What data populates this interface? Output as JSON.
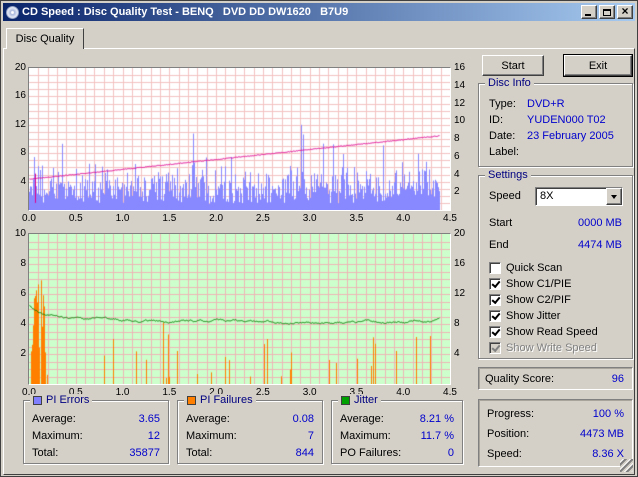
{
  "window": {
    "title": "CD Speed : Disc Quality Test - BENQ   DVD DD DW1620   B7U9"
  },
  "tab": {
    "label": "Disc Quality"
  },
  "buttons": {
    "start": "Start",
    "exit": "Exit"
  },
  "icons": {
    "app": "cd-disc-icon",
    "minimize": "minimize-icon",
    "maximize": "maximize-icon",
    "close": "close-icon",
    "speed_dropdown": "chevron-down-icon"
  },
  "colors": {
    "window_bg": "#d4d0c8",
    "titlebar_left": "#0a246a",
    "titlebar_right": "#a6caf0",
    "value_text": "#0000cc",
    "pi_errors": "#8080ff",
    "pi_failures": "#ff8000",
    "jitter": "#00a000",
    "read_speed": "#e00090"
  },
  "disc_info": {
    "title": "Disc Info",
    "rows": [
      {
        "label": "Type:",
        "value": "DVD+R"
      },
      {
        "label": "ID:",
        "value": "YUDEN000 T02"
      },
      {
        "label": "Date:",
        "value": "23 February 2005"
      },
      {
        "label": "Label:",
        "value": ""
      }
    ]
  },
  "settings": {
    "title": "Settings",
    "speed": {
      "label": "Speed",
      "value": "8X"
    },
    "fields": [
      {
        "label": "Start",
        "value": "0000 MB"
      },
      {
        "label": "End",
        "value": "4474 MB"
      }
    ],
    "checkboxes": [
      {
        "label": "Quick Scan",
        "checked": false,
        "enabled": true
      },
      {
        "label": "Show C1/PIE",
        "checked": true,
        "enabled": true
      },
      {
        "label": "Show C2/PIF",
        "checked": true,
        "enabled": true
      },
      {
        "label": "Show Jitter",
        "checked": true,
        "enabled": true
      },
      {
        "label": "Show Read Speed",
        "checked": true,
        "enabled": true
      },
      {
        "label": "Show Write Speed",
        "checked": true,
        "enabled": false
      }
    ]
  },
  "quality": {
    "label": "Quality Score:",
    "value": "96"
  },
  "status_panel": {
    "rows": [
      {
        "label": "Progress:",
        "value": "100 %"
      },
      {
        "label": "Position:",
        "value": "4473 MB"
      },
      {
        "label": "Speed:",
        "value": "8.36 X"
      }
    ]
  },
  "stats": {
    "boxes": [
      {
        "title": "PI Errors",
        "color": "#8080ff",
        "rows": [
          {
            "label": "Average:",
            "value": "3.65"
          },
          {
            "label": "Maximum:",
            "value": "12"
          },
          {
            "label": "Total:",
            "value": "35877"
          }
        ]
      },
      {
        "title": "PI Failures",
        "color": "#ff8000",
        "rows": [
          {
            "label": "Average:",
            "value": "0.08"
          },
          {
            "label": "Maximum:",
            "value": "7"
          },
          {
            "label": "Total:",
            "value": "844"
          }
        ]
      },
      {
        "title": "Jitter",
        "color": "#00a000",
        "rows": [
          {
            "label": "Average:",
            "value": "8.21 %"
          },
          {
            "label": "Maximum:",
            "value": "11.7 %"
          },
          {
            "label": "PO Failures:",
            "value": "0"
          }
        ]
      }
    ]
  },
  "chart_data": [
    {
      "type": "bar",
      "name": "PI Errors / Read Speed",
      "x_range": [
        0,
        4.5
      ],
      "x_unit": "GB",
      "x_ticks": [
        "0.0",
        "0.5",
        "1.0",
        "1.5",
        "2.0",
        "2.5",
        "3.0",
        "3.5",
        "4.0",
        "4.5"
      ],
      "left_axis": {
        "min": 0,
        "max": 20,
        "ticks": [
          20,
          16,
          12,
          8,
          4
        ]
      },
      "right_axis": {
        "min": 0,
        "max": 16,
        "ticks": [
          16,
          14,
          12,
          10,
          8,
          6,
          4,
          2
        ]
      },
      "background": "#ffffff",
      "grid_color": "#f4c2c2",
      "grid_divisions": {
        "x": 45,
        "y": 20
      },
      "data_end_x": 4.38,
      "series": [
        {
          "name": "PI Errors",
          "type": "spikes",
          "axis": "left",
          "color": "#8888ff",
          "average": 3.65,
          "maximum": 12,
          "total": 35877
        },
        {
          "name": "Read Speed",
          "type": "line",
          "axis": "right",
          "color": "#e00090",
          "start_value": 3.46,
          "end_value": 8.36
        }
      ]
    },
    {
      "type": "bar",
      "name": "PI Failures / Jitter",
      "x_range": [
        0,
        4.5
      ],
      "x_unit": "GB",
      "x_ticks": [
        "0.0",
        "0.5",
        "1.0",
        "1.5",
        "2.0",
        "2.5",
        "3.0",
        "3.5",
        "4.0",
        "4.5"
      ],
      "left_axis": {
        "min": 0,
        "max": 10,
        "ticks": [
          10,
          8,
          6,
          4,
          2
        ]
      },
      "right_axis": {
        "min": 0,
        "max": 20,
        "ticks": [
          20,
          16,
          12,
          8,
          4
        ]
      },
      "background": "#ccffcc",
      "grid_color": "#eeb6b6",
      "grid_divisions": {
        "x": 45,
        "y": 20
      },
      "data_end_x": 4.38,
      "series": [
        {
          "name": "PI Failures",
          "type": "spikes",
          "axis": "left",
          "color": "#ff8000",
          "average": 0.08,
          "maximum": 7,
          "total": 844
        },
        {
          "name": "Jitter",
          "type": "line",
          "axis": "right",
          "color": "#008000",
          "average": 8.21,
          "maximum": 11.7
        }
      ]
    }
  ]
}
